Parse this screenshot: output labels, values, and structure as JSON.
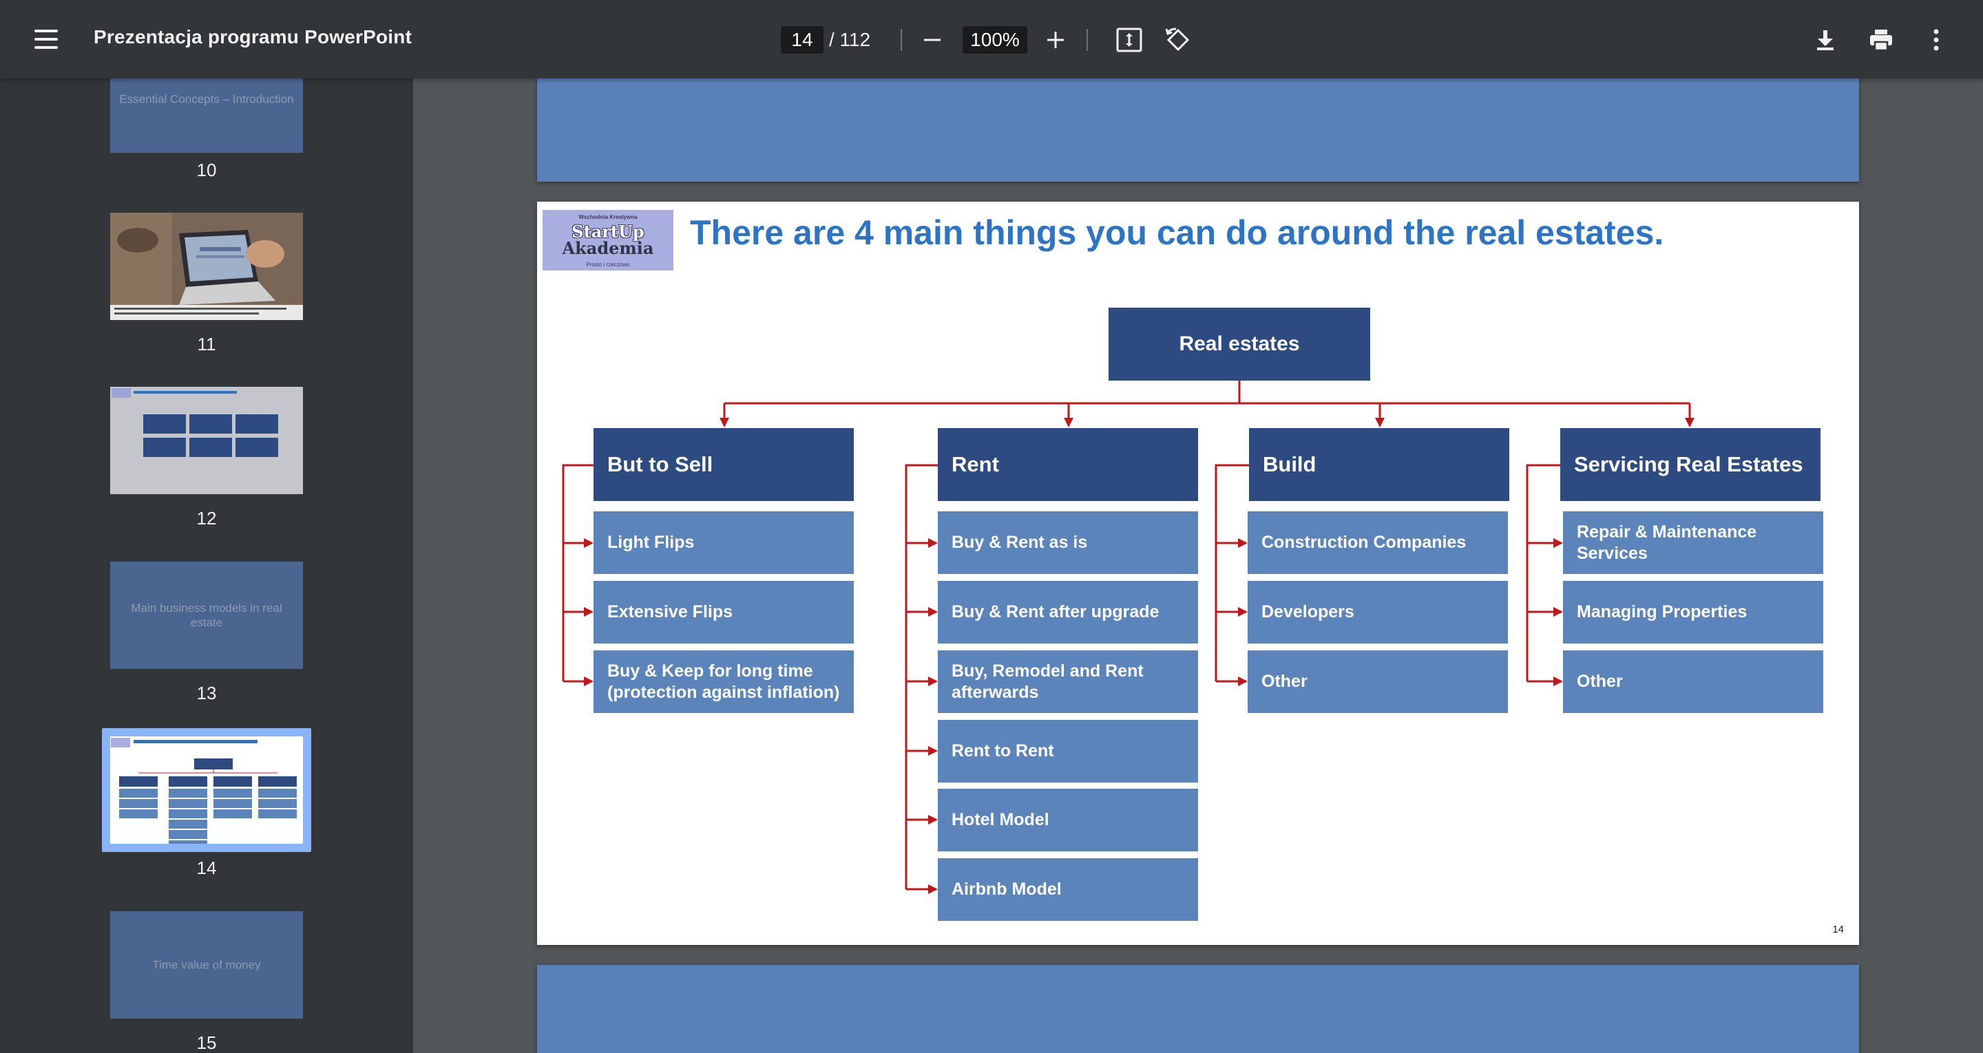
{
  "toolbar": {
    "title": "Prezentacja programu PowerPoint",
    "current_page": "14",
    "total_pages": "/ 112",
    "zoom": "100%"
  },
  "sidebar": {
    "thumbnails": [
      {
        "number": "10",
        "text": "Essential Concepts – Introduction"
      },
      {
        "number": "11",
        "text": ""
      },
      {
        "number": "12",
        "text": ""
      },
      {
        "number": "13",
        "text": "Main business models in real estate"
      },
      {
        "number": "14",
        "text": "",
        "selected": true
      },
      {
        "number": "15",
        "text": "Time value of money"
      }
    ]
  },
  "slide": {
    "title": "There are 4 main things you can do around the real estates.",
    "page_number": "14",
    "logo": {
      "top": "Wschodnia Kreatywna",
      "line1": "StartUp",
      "line2": "Akademia",
      "bottom": "Prosto i rzeczowo"
    },
    "root": "Real estates",
    "columns": [
      {
        "head": "But to Sell",
        "items": [
          "Light Flips",
          "Extensive Flips",
          "Buy & Keep for long time (protection against inflation)"
        ]
      },
      {
        "head": "Rent",
        "items": [
          "Buy & Rent as is",
          "Buy & Rent after  upgrade",
          "Buy, Remodel and Rent afterwards",
          "Rent to Rent",
          "Hotel Model",
          "Airbnb Model"
        ]
      },
      {
        "head": "Build",
        "items": [
          "Construction Companies",
          "Developers",
          "Other"
        ]
      },
      {
        "head": "Servicing Real Estates",
        "items": [
          "Repair & Maintenance Services",
          "Managing Properties",
          "Other"
        ]
      }
    ]
  },
  "colors": {
    "toolbar": "#323639",
    "dark_box": "#2d4b80",
    "light_box": "#5b84bb",
    "connector": "#c0171b",
    "title": "#2e74c6"
  }
}
